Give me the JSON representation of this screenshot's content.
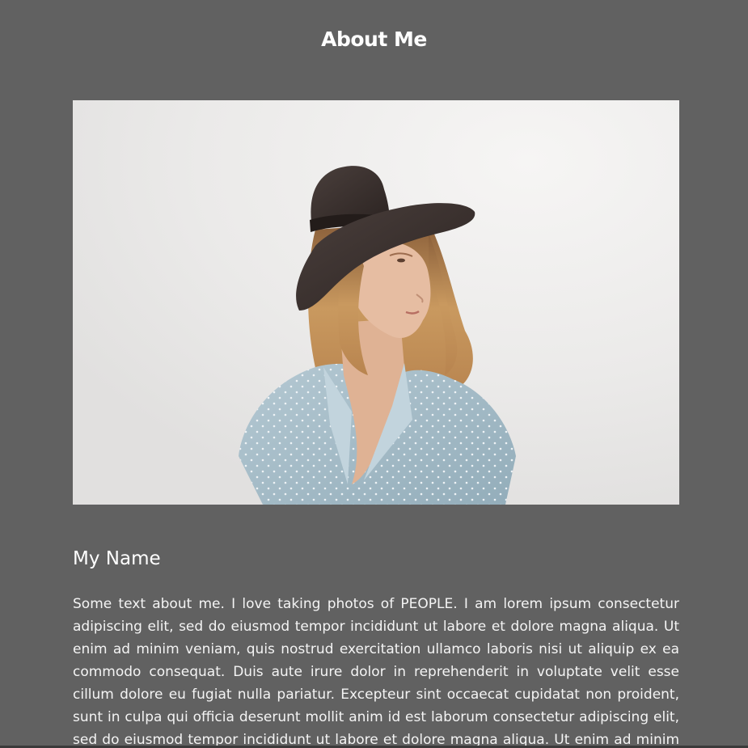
{
  "header": {
    "title": "About Me"
  },
  "photo": {
    "subject": "woman-in-hat-portrait",
    "colors": {
      "background": "#ecebea",
      "hat": "#3d3432",
      "hat_band": "#2a2321",
      "hair": "#c49461",
      "skin": "#e6bda2",
      "shirt": "#a7bdc8",
      "shirt_dots": "#eef3f6"
    }
  },
  "profile": {
    "name": "My Name",
    "bio": "Some text about me. I love taking photos of PEOPLE. I am lorem ipsum consectetur adipiscing elit, sed do eiusmod tempor incididunt ut labore et dolore magna aliqua. Ut enim ad minim veniam, quis nostrud exercitation ullamco laboris nisi ut aliquip ex ea commodo consequat. Duis aute irure dolor in reprehenderit in voluptate velit esse cillum dolore eu fugiat nulla pariatur. Excepteur sint occaecat cupidatat non proident, sunt in culpa qui officia deserunt mollit anim id est laborum consectetur adipiscing elit, sed do eiusmod tempor incididunt ut labore et dolore magna aliqua. Ut enim ad minim"
  },
  "theme": {
    "page_background": "#616161",
    "text_color": "#ffffff"
  }
}
